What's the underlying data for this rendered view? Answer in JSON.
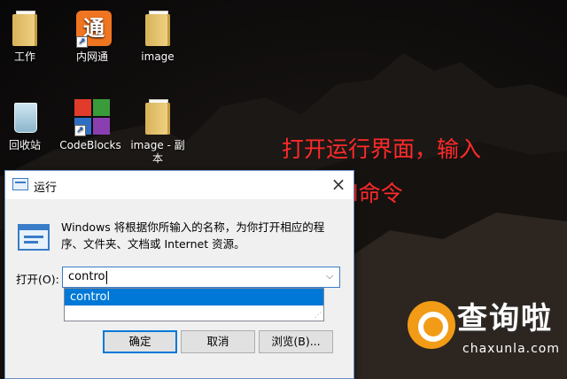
{
  "desktop": {
    "icons": [
      {
        "label": "工作"
      },
      {
        "label": "内网通",
        "glyph_char": "通"
      },
      {
        "label": "image"
      },
      {
        "label": "回收站"
      },
      {
        "label": "CodeBlocks"
      },
      {
        "label": "image - 副本"
      }
    ]
  },
  "annotation": {
    "line1": "打开运行界面，输入",
    "line2": "control命令",
    "color": "#ff2a2a"
  },
  "dialog": {
    "title": "运行",
    "close_glyph": "×",
    "description": "Windows 将根据你所输入的名称，为你打开相应的程序、文件夹、文档或 Internet 资源。",
    "open_label": "打开(O):",
    "input_value": "control",
    "dropdown_arrow": "⌵",
    "suggestions": [
      "control"
    ],
    "buttons": {
      "ok": "确定",
      "cancel": "取消",
      "browse": "浏览(B)..."
    },
    "accent_color": "#0078d7"
  },
  "watermark": {
    "title": "查询啦",
    "domain": "chaxunla.com"
  }
}
